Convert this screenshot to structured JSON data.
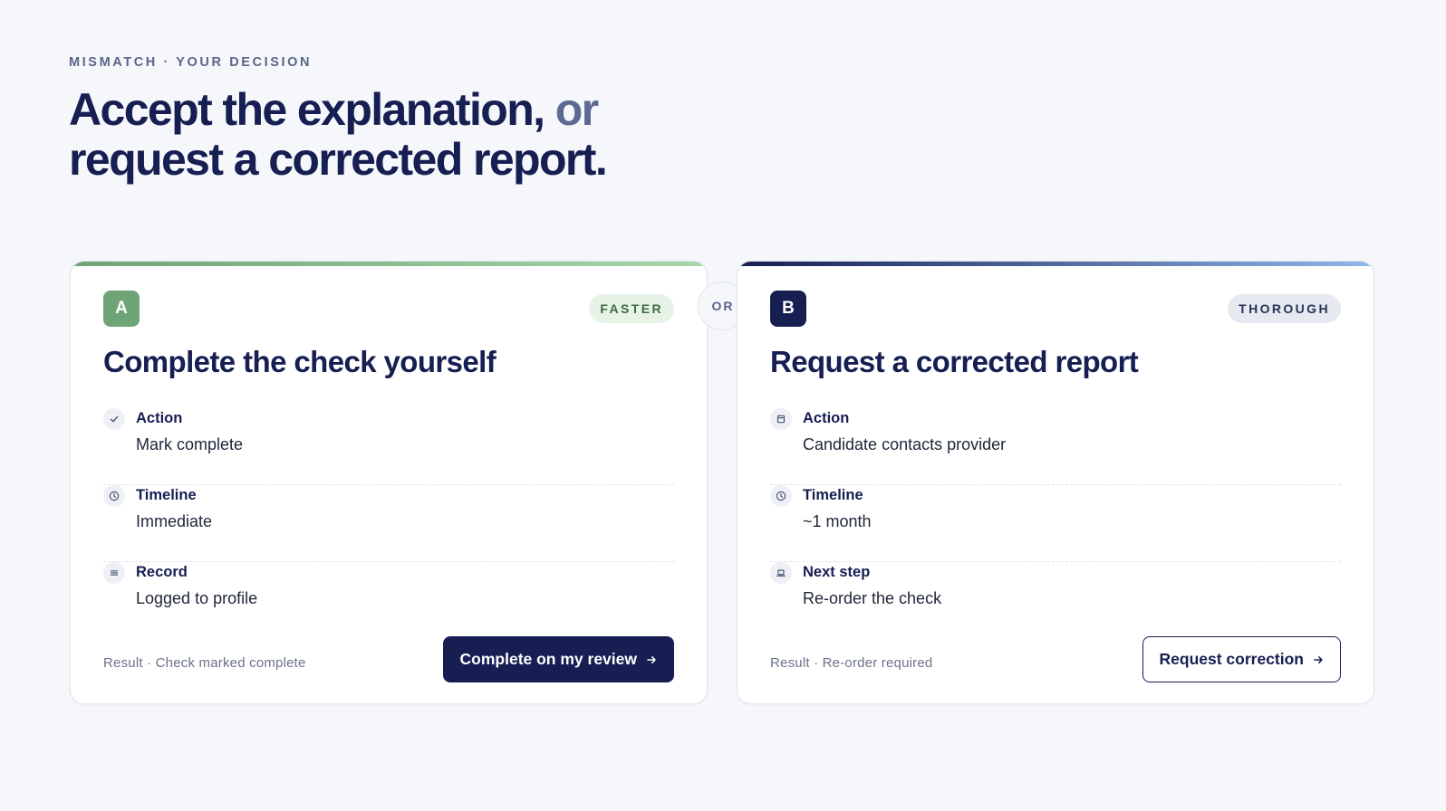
{
  "header": {
    "eyebrow": "MISMATCH · YOUR DECISION",
    "title_part1": "Accept the explanation,",
    "title_muted": "or",
    "title_line2": "request a corrected report."
  },
  "divider_label": "OR",
  "colors": {
    "navy": "#161e52",
    "green": "#6fa476",
    "muted": "#5c6a93",
    "background": "#f5f7fb"
  },
  "options": [
    {
      "letter": "A",
      "tag": "FASTER",
      "title": "Complete the check yourself",
      "rows": [
        {
          "icon": "check-icon",
          "label": "Action",
          "value": "Mark complete"
        },
        {
          "icon": "clock-icon",
          "label": "Timeline",
          "value": "Immediate"
        },
        {
          "icon": "lines-icon",
          "label": "Record",
          "value": "Logged to profile"
        }
      ],
      "result": "Result · Check marked complete",
      "button_label": "Complete on my review"
    },
    {
      "letter": "B",
      "tag": "THOROUGH",
      "title": "Request a corrected report",
      "rows": [
        {
          "icon": "document-icon",
          "label": "Action",
          "value": "Candidate contacts provider"
        },
        {
          "icon": "clock-icon",
          "label": "Timeline",
          "value": "~1 month"
        },
        {
          "icon": "laptop-icon",
          "label": "Next step",
          "value": "Re-order the check"
        }
      ],
      "result": "Result · Re-order required",
      "button_label": "Request correction"
    }
  ]
}
